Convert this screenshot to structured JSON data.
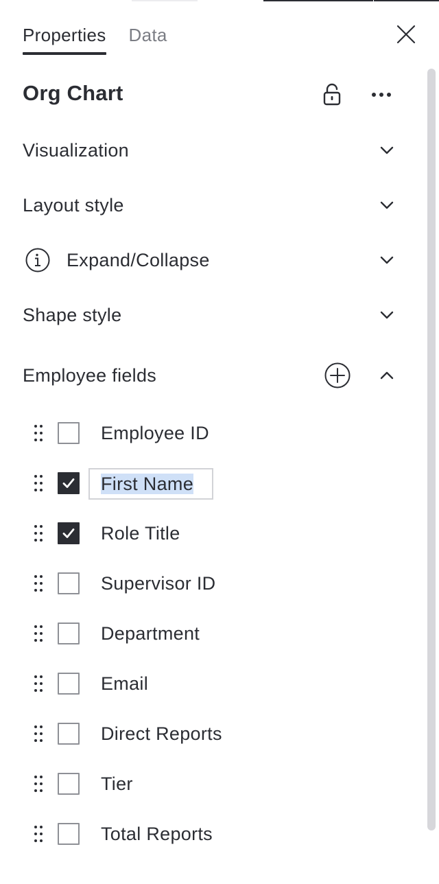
{
  "tabs": [
    {
      "label": "Properties",
      "active": true
    },
    {
      "label": "Data",
      "active": false
    }
  ],
  "panel": {
    "title": "Org Chart",
    "icons": {
      "close": "close-icon",
      "lock": "unlock-icon",
      "more": "more-horizontal-icon"
    }
  },
  "sections": [
    {
      "label": "Visualization",
      "expanded": false
    },
    {
      "label": "Layout style",
      "expanded": false
    },
    {
      "label": "Expand/Collapse",
      "expanded": false,
      "icon": "info-icon"
    },
    {
      "label": "Shape style",
      "expanded": false
    },
    {
      "label": "Employee fields",
      "expanded": true,
      "icon": "add-circle-icon"
    }
  ],
  "fields": [
    {
      "label": "Employee ID",
      "checked": false
    },
    {
      "label": "First Name",
      "checked": true,
      "editing": true
    },
    {
      "label": "Role Title",
      "checked": true
    },
    {
      "label": "Supervisor ID",
      "checked": false
    },
    {
      "label": "Department",
      "checked": false
    },
    {
      "label": "Email",
      "checked": false
    },
    {
      "label": "Direct Reports",
      "checked": false
    },
    {
      "label": "Tier",
      "checked": false
    },
    {
      "label": "Total Reports",
      "checked": false
    }
  ],
  "colors": {
    "text": "#2b2d33",
    "muted": "#7b7d84",
    "checkbox_border": "#8e9096",
    "selection": "#cfe0f7"
  }
}
